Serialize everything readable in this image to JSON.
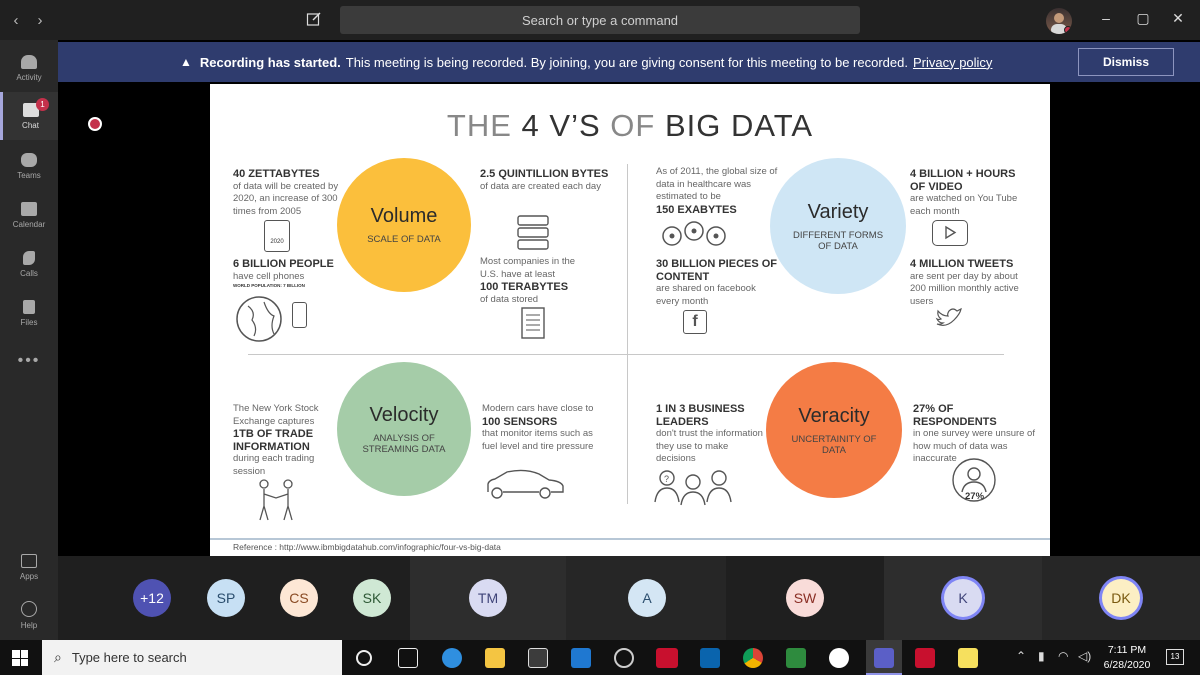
{
  "titlebar": {
    "back": "‹",
    "forward": "›",
    "search_placeholder": "Search or type a command",
    "minimize": "–",
    "maximize": "▢",
    "close": "✕"
  },
  "rail": {
    "items": [
      {
        "label": "Activity"
      },
      {
        "label": "Chat",
        "badge": "1"
      },
      {
        "label": "Teams"
      },
      {
        "label": "Calendar"
      },
      {
        "label": "Calls"
      },
      {
        "label": "Files"
      }
    ],
    "more": "•••",
    "apps": "Apps",
    "help": "Help"
  },
  "banner": {
    "bold": "Recording has started.",
    "text": "This meeting is being recorded. By joining, you are giving consent for this meeting to be recorded.",
    "link": "Privacy policy",
    "dismiss": "Dismiss"
  },
  "slide": {
    "title_a": "THE",
    "title_b": "4 V’S",
    "title_c": "OF",
    "title_d": "BIG DATA",
    "volume": {
      "name": "Volume",
      "sub": "SCALE OF DATA",
      "color": "#fbbf3c"
    },
    "variety": {
      "name": "Variety",
      "sub": "DIFFERENT FORMS OF DATA",
      "color": "#cfe6f5"
    },
    "velocity": {
      "name": "Velocity",
      "sub": "ANALYSIS OF STREAMING DATA",
      "color": "#a5cca8"
    },
    "veracity": {
      "name": "Veracity",
      "sub": "UNCERTAINITY OF DATA",
      "color": "#f47c45"
    },
    "t1_bold": "40 ZETTABYTES",
    "t1": "of data will be created by 2020, an increase of 300 times from 2005",
    "year_label": "2020",
    "t2_bold": "6 BILLION PEOPLE",
    "t2": "have cell phones",
    "t2_small": "WORLD POPULATION: 7 BILLION",
    "t3_bold": "2.5 QUINTILLION BYTES",
    "t3": "of data are created each day",
    "t4": "Most companies in the U.S. have at least",
    "t4_bold": "100 TERABYTES",
    "t4_b": "of data stored",
    "t5": "As of 2011, the global size of data in healthcare was estimated to be",
    "t5_bold": "150 EXABYTES",
    "t6_bold": "30 BILLION PIECES OF CONTENT",
    "t6": "are shared on facebook every month",
    "t7_bold": "4 BILLION + HOURS OF VIDEO",
    "t7": "are watched on You Tube each month",
    "t8_bold": "4 MILLION TWEETS",
    "t8": "are sent per day by about 200 million monthly active users",
    "t9": "The New York Stock Exchange captures",
    "t9_bold": "1TB OF TRADE INFORMATION",
    "t9_b": "during each trading session",
    "t10": "Modern cars have close to",
    "t10_bold": "100 SENSORS",
    "t10_b": "that monitor items such as fuel level and tire pressure",
    "t11_bold": "1 IN 3 BUSINESS LEADERS",
    "t11": "don't trust the information they use to make decisions",
    "t12_bold": "27% OF RESPONDENTS",
    "t12": "in one survey were unsure of how much of data was inaccurate",
    "pct_label": "27%",
    "reference": "Reference : http://www.ibmbigdatahub.com/infographic/four-vs-big-data"
  },
  "participants": [
    {
      "initials": "+12",
      "bg": "#4f52b2",
      "fg": "#ffffff"
    },
    {
      "initials": "SP",
      "bg": "#c7e0f4",
      "fg": "#2b4e6e"
    },
    {
      "initials": "CS",
      "bg": "#fde7d5",
      "fg": "#8a4b24"
    },
    {
      "initials": "SK",
      "bg": "#cfe8d4",
      "fg": "#2e5936"
    },
    {
      "initials": "TM",
      "bg": "#d9dbf2",
      "fg": "#3f4479"
    },
    {
      "initials": "A",
      "bg": "#d4e6f4",
      "fg": "#2b4e6e"
    },
    {
      "initials": "SW",
      "bg": "#f9dcd9",
      "fg": "#8a2e24"
    },
    {
      "initials": "K",
      "bg": "#d9dbf2",
      "fg": "#3f4479"
    },
    {
      "initials": "DK",
      "bg": "#fcefc4",
      "fg": "#7a5a10"
    }
  ],
  "taskbar": {
    "search": "Type here to search",
    "time": "7:11 PM",
    "date": "6/28/2020",
    "notif": "13"
  }
}
